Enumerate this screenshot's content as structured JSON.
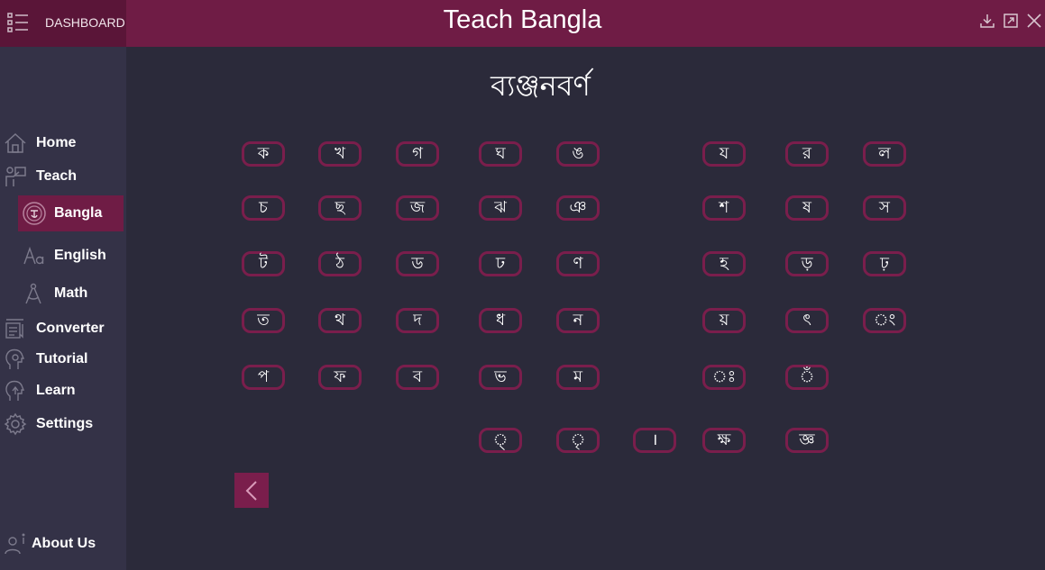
{
  "header": {
    "dashboard_label": "DASHBOARD",
    "title": "Teach Bangla",
    "icons": [
      "menu-icon",
      "download-icon",
      "maximize-icon",
      "close-icon"
    ]
  },
  "sidebar": {
    "items": [
      {
        "label": "Home",
        "icon": "home-icon"
      },
      {
        "label": "Teach",
        "icon": "teach-icon"
      },
      {
        "label": "Bangla",
        "icon": "bangla-icon",
        "active": true
      },
      {
        "label": "English",
        "icon": "english-icon"
      },
      {
        "label": "Math",
        "icon": "math-icon"
      },
      {
        "label": "Converter",
        "icon": "converter-icon"
      },
      {
        "label": "Tutorial",
        "icon": "tutorial-icon"
      },
      {
        "label": "Learn",
        "icon": "learn-icon"
      },
      {
        "label": "Settings",
        "icon": "settings-icon"
      }
    ],
    "about": {
      "label": "About Us",
      "icon": "about-icon"
    }
  },
  "main": {
    "title": "ব্যঞ্জনবর্ণ",
    "rows": [
      [
        "ক",
        "খ",
        "গ",
        "ঘ",
        "ঙ",
        "য",
        "র",
        "ল"
      ],
      [
        "চ",
        "ছ",
        "জ",
        "ঝ",
        "ঞ",
        "শ",
        "ষ",
        "স"
      ],
      [
        "ট",
        "ঠ",
        "ড",
        "ঢ",
        "ণ",
        "হ",
        "ড়",
        "ঢ়"
      ],
      [
        "ত",
        "থ",
        "দ",
        "ধ",
        "ন",
        "য়",
        "ৎ",
        "ং"
      ],
      [
        "প",
        "ফ",
        "ব",
        "ভ",
        "ম",
        "ঃ",
        "ঁ"
      ],
      [
        "্",
        "ৃ",
        "।",
        "ক্ষ",
        "জ্ঞ"
      ]
    ],
    "back_icon": "chevron-left-icon"
  },
  "colors": {
    "accent": "#6f1c45",
    "button_border": "#7a1e4c",
    "background": "#2b2a3a",
    "sidebar": "#343247"
  }
}
